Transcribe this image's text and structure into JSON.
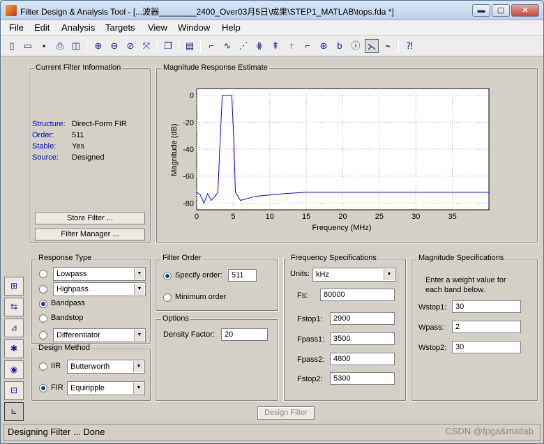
{
  "window": {
    "title": "Filter Design & Analysis Tool -  [...波器________2400_Over03月5日\\成果\\STEP1_MATLAB\\tops.fda *]",
    "min": "▬",
    "max": "▢",
    "close": "✕"
  },
  "menu": [
    "File",
    "Edit",
    "Analysis",
    "Targets",
    "View",
    "Window",
    "Help"
  ],
  "current_filter": {
    "title": "Current Filter Information",
    "structure_label": "Structure:",
    "structure": "Direct-Form FIR",
    "order_label": "Order:",
    "order": "511",
    "stable_label": "Stable:",
    "stable": "Yes",
    "source_label": "Source:",
    "source": "Designed",
    "store_btn": "Store Filter ...",
    "manager_btn": "Filter Manager ..."
  },
  "chart_data": {
    "type": "line",
    "title": "Magnitude Response Estimate",
    "xlabel": "Frequency (MHz)",
    "ylabel": "Magnitude (dB)",
    "xlim": [
      0,
      40
    ],
    "ylim": [
      -85,
      5
    ],
    "xticks": [
      "0",
      "5",
      "10",
      "15",
      "20",
      "25",
      "30",
      "35"
    ],
    "yticks": [
      "0",
      "-20",
      "-40",
      "-60",
      "-80"
    ],
    "grid": true,
    "series": [
      {
        "color": "#0000ff",
        "x": [
          0,
          0.5,
          1,
          1.5,
          2,
          2.5,
          2.9,
          3.2,
          3.5,
          4.8,
          5.1,
          5.3,
          6,
          8,
          10,
          12,
          15,
          20,
          25,
          30,
          35,
          40
        ],
        "y": [
          -72,
          -74,
          -80,
          -73,
          -78,
          -75,
          -72,
          -35,
          0,
          0,
          -35,
          -72,
          -78,
          -75,
          -74,
          -73,
          -72,
          -72,
          -72,
          -72,
          -72,
          -72
        ]
      }
    ]
  },
  "response_type": {
    "title": "Response Type",
    "lowpass": "Lowpass",
    "highpass": "Highpass",
    "bandpass": "Bandpass",
    "bandstop": "Bandstop",
    "differentiator": "Differentiator"
  },
  "design_method": {
    "title": "Design Method",
    "iir": "IIR",
    "iir_type": "Butterworth",
    "fir": "FIR",
    "fir_type": "Equiripple"
  },
  "filter_order": {
    "title": "Filter Order",
    "specify": "Specify order:",
    "order_value": "511",
    "minimum": "Minimum order"
  },
  "options": {
    "title": "Options",
    "density_label": "Density Factor:",
    "density_value": "20"
  },
  "freq_spec": {
    "title": "Frequency Specifications",
    "units_label": "Units:",
    "units": "kHz",
    "fs_label": "Fs:",
    "fs": "80000",
    "fstop1_label": "Fstop1:",
    "fstop1": "2900",
    "fpass1_label": "Fpass1:",
    "fpass1": "3500",
    "fpass2_label": "Fpass2:",
    "fpass2": "4800",
    "fstop2_label": "Fstop2:",
    "fstop2": "5300"
  },
  "mag_spec": {
    "title": "Magnitude Specifications",
    "note1": "Enter a weight value for",
    "note2": "each band below.",
    "wstop1_label": "Wstop1:",
    "wstop1": "30",
    "wpass_label": "Wpass:",
    "wpass": "2",
    "wstop2_label": "Wstop2:",
    "wstop2": "30"
  },
  "design_btn": "Design Filter",
  "status": "Designing Filter ... Done",
  "watermark": "CSDN @fpga&matlab"
}
